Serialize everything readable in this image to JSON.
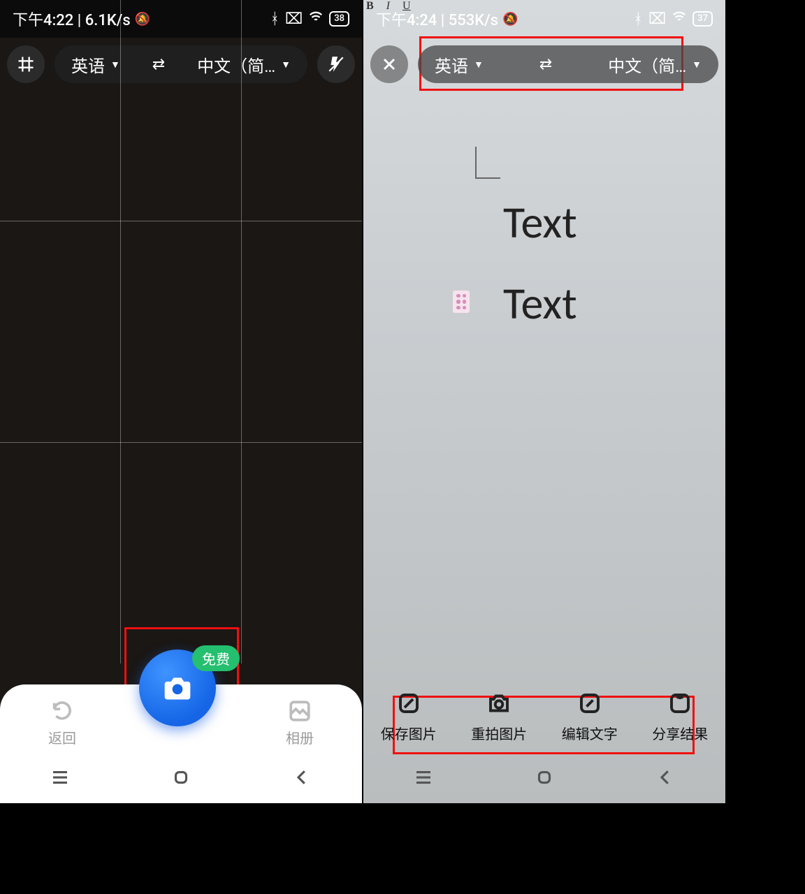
{
  "left": {
    "status": {
      "time_rate": "下午4:22 | 6.1K/s",
      "battery": "38"
    },
    "lang": {
      "source": "英语",
      "target": "中文（简…"
    },
    "shelf": {
      "back": "返回",
      "gallery": "相册"
    },
    "shutter": {
      "badge": "免费"
    }
  },
  "right": {
    "status": {
      "time_rate": "下午4:24 | 553K/s",
      "battery": "37"
    },
    "lang": {
      "source": "英语",
      "target": "中文（简…"
    },
    "content": {
      "line1": "Text",
      "line2": "Text"
    },
    "actions": {
      "save": "保存图片",
      "retake": "重拍图片",
      "edit": "编辑文字",
      "share": "分享结果"
    }
  }
}
